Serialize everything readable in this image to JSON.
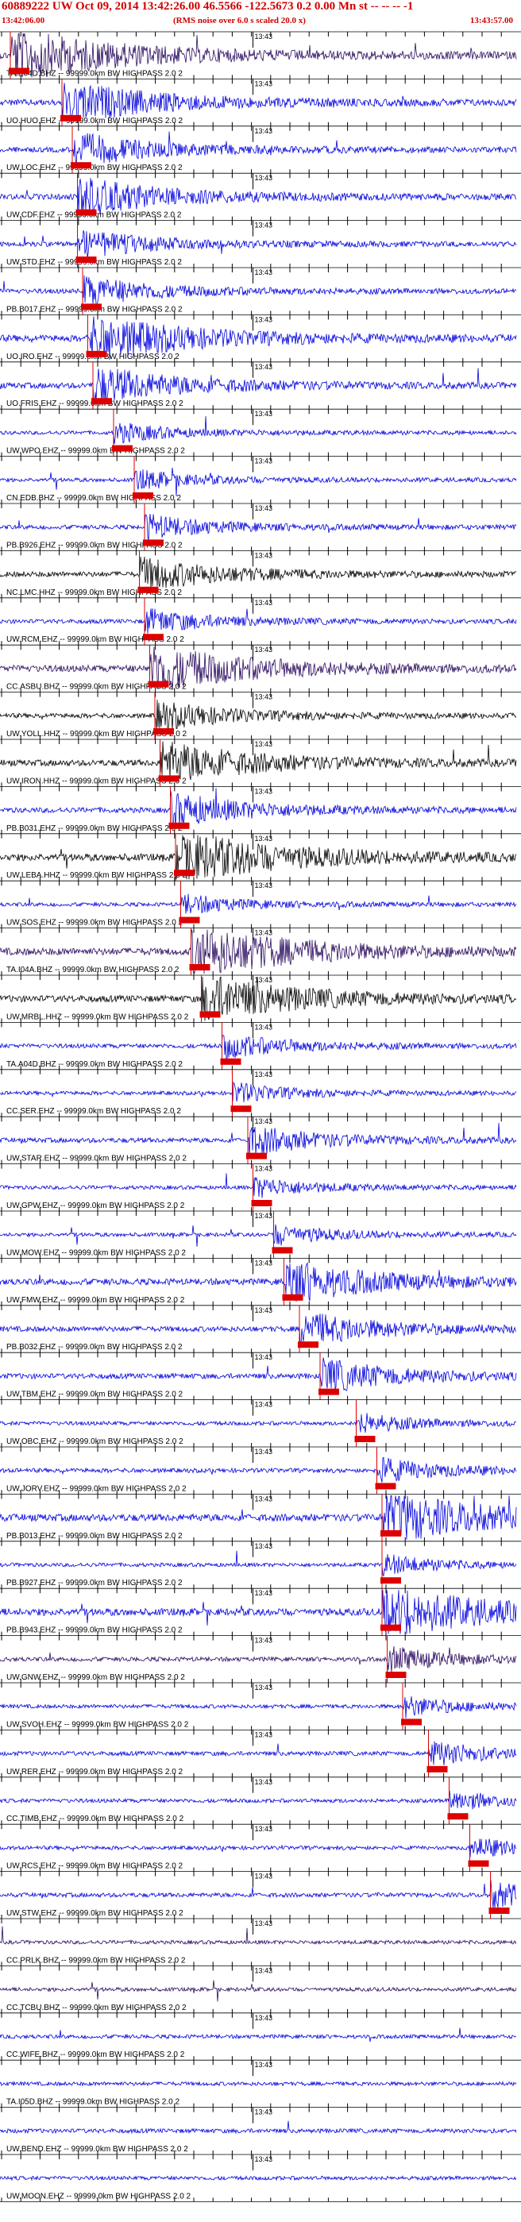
{
  "header": {
    "title": "60889222 UW Oct 09, 2014 13:42:26.00   46.5566 -122.5673  0.2 0.00 Mn st -- -- --  -1",
    "start_time": "13:42:06.00",
    "note": "(RMS noise over 6.0 s scaled 20.0 x)",
    "end_time": "13:43:57.00"
  },
  "colors": {
    "trace_blue": "#0000dd",
    "trace_black": "#000000",
    "trace_purple": "#2a0a5e",
    "pick_red": "#dd0000",
    "grid": "#000000"
  },
  "chart_data": {
    "type": "seismogram",
    "time_marker_label": "13:43",
    "traces": [
      {
        "label": "TA.E04D.BHZ -- 99999.0km BW  HIGHPASS  2.0  2",
        "color": "#2a0a5e",
        "pick": 0.02,
        "amp": 1.0
      },
      {
        "label": "UO.HUO.EHZ -- 99999.0km BW  HIGHPASS  2.0  2",
        "color": "#0000dd",
        "pick": 0.12,
        "amp": 0.8
      },
      {
        "label": "UW.LOC.EHZ -- 99999.0km BW  HIGHPASS  2.0  2",
        "color": "#0000dd",
        "pick": 0.14,
        "amp": 0.6
      },
      {
        "label": "UW.CDF.EHZ -- 99999.0km BW  HIGHPASS  2.0  2",
        "color": "#0000dd",
        "pick": 0.15,
        "amp": 0.7
      },
      {
        "label": "UW.STD.EHZ -- 99999.0km BW  HIGHPASS  2.0  2",
        "color": "#0000dd",
        "pick": 0.15,
        "amp": 0.5
      },
      {
        "label": "PB.B017.EHZ -- 99999.0km BW  HIGHPASS  2.0  2",
        "color": "#0000dd",
        "pick": 0.16,
        "amp": 0.5
      },
      {
        "label": "UO.IRO.EHZ -- 99999.0km BW  HIGHPASS  2.0  2",
        "color": "#0000dd",
        "pick": 0.17,
        "amp": 0.9
      },
      {
        "label": "UO.FRIS.EHZ -- 99999.0km BW  HIGHPASS  2.0  2",
        "color": "#0000dd",
        "pick": 0.18,
        "amp": 0.7
      },
      {
        "label": "UW.WPO.EHZ -- 99999.0km BW  HIGHPASS  2.0  2",
        "color": "#0000dd",
        "pick": 0.22,
        "amp": 0.3
      },
      {
        "label": "CN.EDB.BHZ -- 99999.0km BW  HIGHPASS  2.0  2",
        "color": "#0000dd",
        "pick": 0.26,
        "amp": 0.3
      },
      {
        "label": "PB.B926.EHZ -- 99999.0km BW  HIGHPASS  2.0  2",
        "color": "#0000dd",
        "pick": 0.28,
        "amp": 0.4
      },
      {
        "label": "NC.LMC.HHZ -- 99999.0km BW  HIGHPASS  2.0  2",
        "color": "#000000",
        "pick": 0.27,
        "amp": 0.6
      },
      {
        "label": "UW.RCM.EHZ -- 99999.0km BW  HIGHPASS  2.0  2",
        "color": "#0000dd",
        "pick": 0.28,
        "amp": 0.4
      },
      {
        "label": "CC.ASBU.BHZ -- 99999.0km BW  HIGHPASS  2.0  2",
        "color": "#2a0a5e",
        "pick": 0.29,
        "amp": 0.9
      },
      {
        "label": "UW.YOLL.HHZ -- 99999.0km BW  HIGHPASS  2.0  2",
        "color": "#000000",
        "pick": 0.3,
        "amp": 0.5
      },
      {
        "label": "UW.IRON.HHZ -- 99999.0km BW  HIGHPASS  2.0  2",
        "color": "#000000",
        "pick": 0.31,
        "amp": 0.8
      },
      {
        "label": "PB.B031.EHZ -- 99999.0km BW  HIGHPASS  2.0  2",
        "color": "#0000dd",
        "pick": 0.33,
        "amp": 0.6
      },
      {
        "label": "UW.LEBA.HHZ -- 99999.0km BW  HIGHPASS  2.0  2",
        "color": "#000000",
        "pick": 0.34,
        "amp": 1.0
      },
      {
        "label": "UW.SOS.EHZ -- 99999.0km BW  HIGHPASS  2.0  2",
        "color": "#0000dd",
        "pick": 0.35,
        "amp": 0.3
      },
      {
        "label": "TA.I04A.BHZ -- 99999.0km BW  HIGHPASS  2.0  2",
        "color": "#2a0a5e",
        "pick": 0.37,
        "amp": 1.0
      },
      {
        "label": "UW.MRBL.HHZ -- 99999.0km BW  HIGHPASS  2.0  2",
        "color": "#000000",
        "pick": 0.39,
        "amp": 0.9
      },
      {
        "label": "TA.A04D.BHZ -- 99999.0km BW  HIGHPASS  2.0  2",
        "color": "#0000dd",
        "pick": 0.43,
        "amp": 0.4
      },
      {
        "label": "CC.SER.EHZ -- 99999.0km BW  HIGHPASS  2.0  2",
        "color": "#0000dd",
        "pick": 0.45,
        "amp": 0.3
      },
      {
        "label": "UW.STAR.EHZ -- 99999.0km BW  HIGHPASS  2.0  2",
        "color": "#0000dd",
        "pick": 0.48,
        "amp": 0.5
      },
      {
        "label": "UW.GPW.EHZ -- 99999.0km BW  HIGHPASS  2.0  2",
        "color": "#0000dd",
        "pick": 0.49,
        "amp": 0.3
      },
      {
        "label": "UW.MOW.EHZ -- 99999.0km BW  HIGHPASS  2.0  2",
        "color": "#0000dd",
        "pick": 0.53,
        "amp": 0.3
      },
      {
        "label": "UW.FMW.EHZ -- 99999.0km BW  HIGHPASS  2.0  2",
        "color": "#0000dd",
        "pick": 0.55,
        "amp": 0.8
      },
      {
        "label": "PB.B032.EHZ -- 99999.0km BW  HIGHPASS  2.0  2",
        "color": "#0000dd",
        "pick": 0.58,
        "amp": 0.6
      },
      {
        "label": "UW.TBM.EHZ -- 99999.0km BW  HIGHPASS  2.0  2",
        "color": "#0000dd",
        "pick": 0.62,
        "amp": 0.6
      },
      {
        "label": "UW.OBC.EHZ -- 99999.0km BW  HIGHPASS  2.0  2",
        "color": "#0000dd",
        "pick": 0.69,
        "amp": 0.3
      },
      {
        "label": "UW.JORV.EHZ -- 99999.0km BW  HIGHPASS  2.0  2",
        "color": "#0000dd",
        "pick": 0.73,
        "amp": 0.4
      },
      {
        "label": "PB.B013.EHZ -- 99999.0km BW  HIGHPASS  2.0  2",
        "color": "#0000dd",
        "pick": 0.74,
        "amp": 1.0
      },
      {
        "label": "PB.B927.EHZ -- 99999.0km BW  HIGHPASS  2.0  2",
        "color": "#0000dd",
        "pick": 0.74,
        "amp": 0.3
      },
      {
        "label": "PB.B943.EHZ -- 99999.0km BW  HIGHPASS  2.0  2",
        "color": "#0000dd",
        "pick": 0.74,
        "amp": 1.0
      },
      {
        "label": "UW.GNW.EHZ -- 99999.0km BW  HIGHPASS  2.0  2",
        "color": "#2a0a5e",
        "pick": 0.75,
        "amp": 0.4
      },
      {
        "label": "UW.SVOH.EHZ -- 99999.0km BW  HIGHPASS  2.0  2",
        "color": "#0000dd",
        "pick": 0.78,
        "amp": 0.3
      },
      {
        "label": "UW.RER.EHZ -- 99999.0km BW  HIGHPASS  2.0  2",
        "color": "#0000dd",
        "pick": 0.83,
        "amp": 0.4
      },
      {
        "label": "CC.TIMB.EHZ -- 99999.0km BW  HIGHPASS  2.0  2",
        "color": "#0000dd",
        "pick": 0.87,
        "amp": 0.3
      },
      {
        "label": "UW.RCS.EHZ -- 99999.0km BW  HIGHPASS  2.0  2",
        "color": "#0000dd",
        "pick": 0.91,
        "amp": 0.3
      },
      {
        "label": "UW.STW.EHZ -- 99999.0km BW  HIGHPASS  2.0  2",
        "color": "#0000dd",
        "pick": 0.95,
        "amp": 0.4
      },
      {
        "label": "CC.PRLK.BHZ -- 99999.0km BW  HIGHPASS  2.0  2",
        "color": "#2a0a5e",
        "pick": null,
        "amp": 0.3
      },
      {
        "label": "CC.TCBU.BHZ -- 99999.0km BW  HIGHPASS  2.0  2",
        "color": "#2a0a5e",
        "pick": null,
        "amp": 0.3
      },
      {
        "label": "CC.WIFE.BHZ -- 99999.0km BW  HIGHPASS  2.0  2",
        "color": "#0000dd",
        "pick": null,
        "amp": 0.3
      },
      {
        "label": "TA.I05D.BHZ -- 99999.0km BW  HIGHPASS  2.0  2",
        "color": "#0000dd",
        "pick": null,
        "amp": 0.3
      },
      {
        "label": "UW.BEND.EHZ -- 99999.0km BW  HIGHPASS  2.0  2",
        "color": "#0000dd",
        "pick": null,
        "amp": 0.4
      },
      {
        "label": "UW.MOON.EHZ -- 99999.0km BW  HIGHPASS  2.0  2",
        "color": "#0000dd",
        "pick": null,
        "amp": 0.3
      }
    ]
  }
}
